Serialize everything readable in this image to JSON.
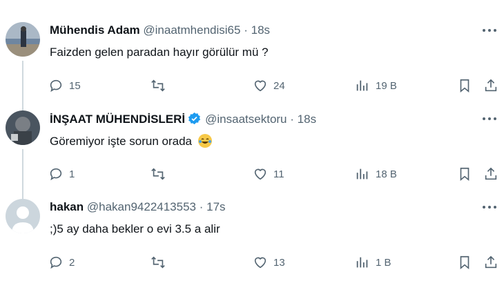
{
  "tweets": [
    {
      "name": "Mühendis Adam",
      "handle": "@inaatmhendisi65",
      "dot": "·",
      "time": "18s",
      "text": "Faizden gelen paradan hayır görülür mü ?",
      "replies": "15",
      "retweets": "",
      "likes": "24",
      "views": "19 B",
      "verified": false
    },
    {
      "name": "İNŞAAT MÜHENDİSLERİ",
      "handle": "@insaatsektoru",
      "dot": "·",
      "time": "18s",
      "text": "Göremiyor işte sorun orada",
      "replies": "1",
      "retweets": "",
      "likes": "11",
      "views": "18 B",
      "verified": true
    },
    {
      "name": "hakan",
      "handle": "@hakan9422413553",
      "dot": "·",
      "time": "17s",
      "text": ";)5 ay daha bekler o evi 3.5 a alir",
      "replies": "2",
      "retweets": "",
      "likes": "13",
      "views": "1 B",
      "verified": false
    }
  ],
  "colors": {
    "text": "#0f1419",
    "muted": "#536471",
    "verified_blue": "#1d9bf0",
    "thread_line": "#cfd9de"
  },
  "icons": [
    "reply-icon",
    "retweet-icon",
    "like-icon",
    "views-icon",
    "bookmark-icon",
    "share-icon",
    "more-icon",
    "verified-badge-icon",
    "face-with-tears-of-joy-emoji"
  ]
}
